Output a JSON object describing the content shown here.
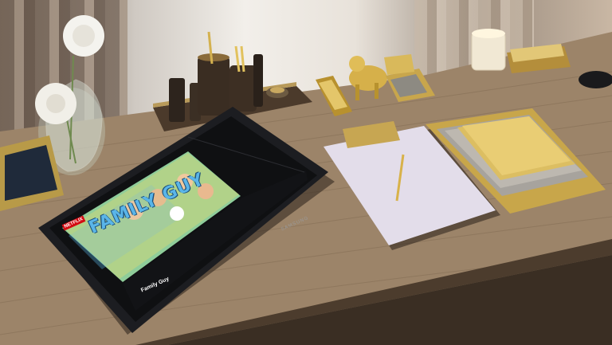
{
  "scene": {
    "description_free": true,
    "colors": {
      "desk": "#9c8469",
      "wall": "#efeae3",
      "gold": "#d8b24a",
      "paper": "#e3ddea",
      "tablet": "#1c1d21"
    }
  },
  "tablet_screen": {
    "brand_tag": "NETFLIX",
    "show_logo": "FAMILY GUY",
    "show_title": "Family Guy"
  },
  "device": {
    "brand": "SAMSUNG"
  }
}
